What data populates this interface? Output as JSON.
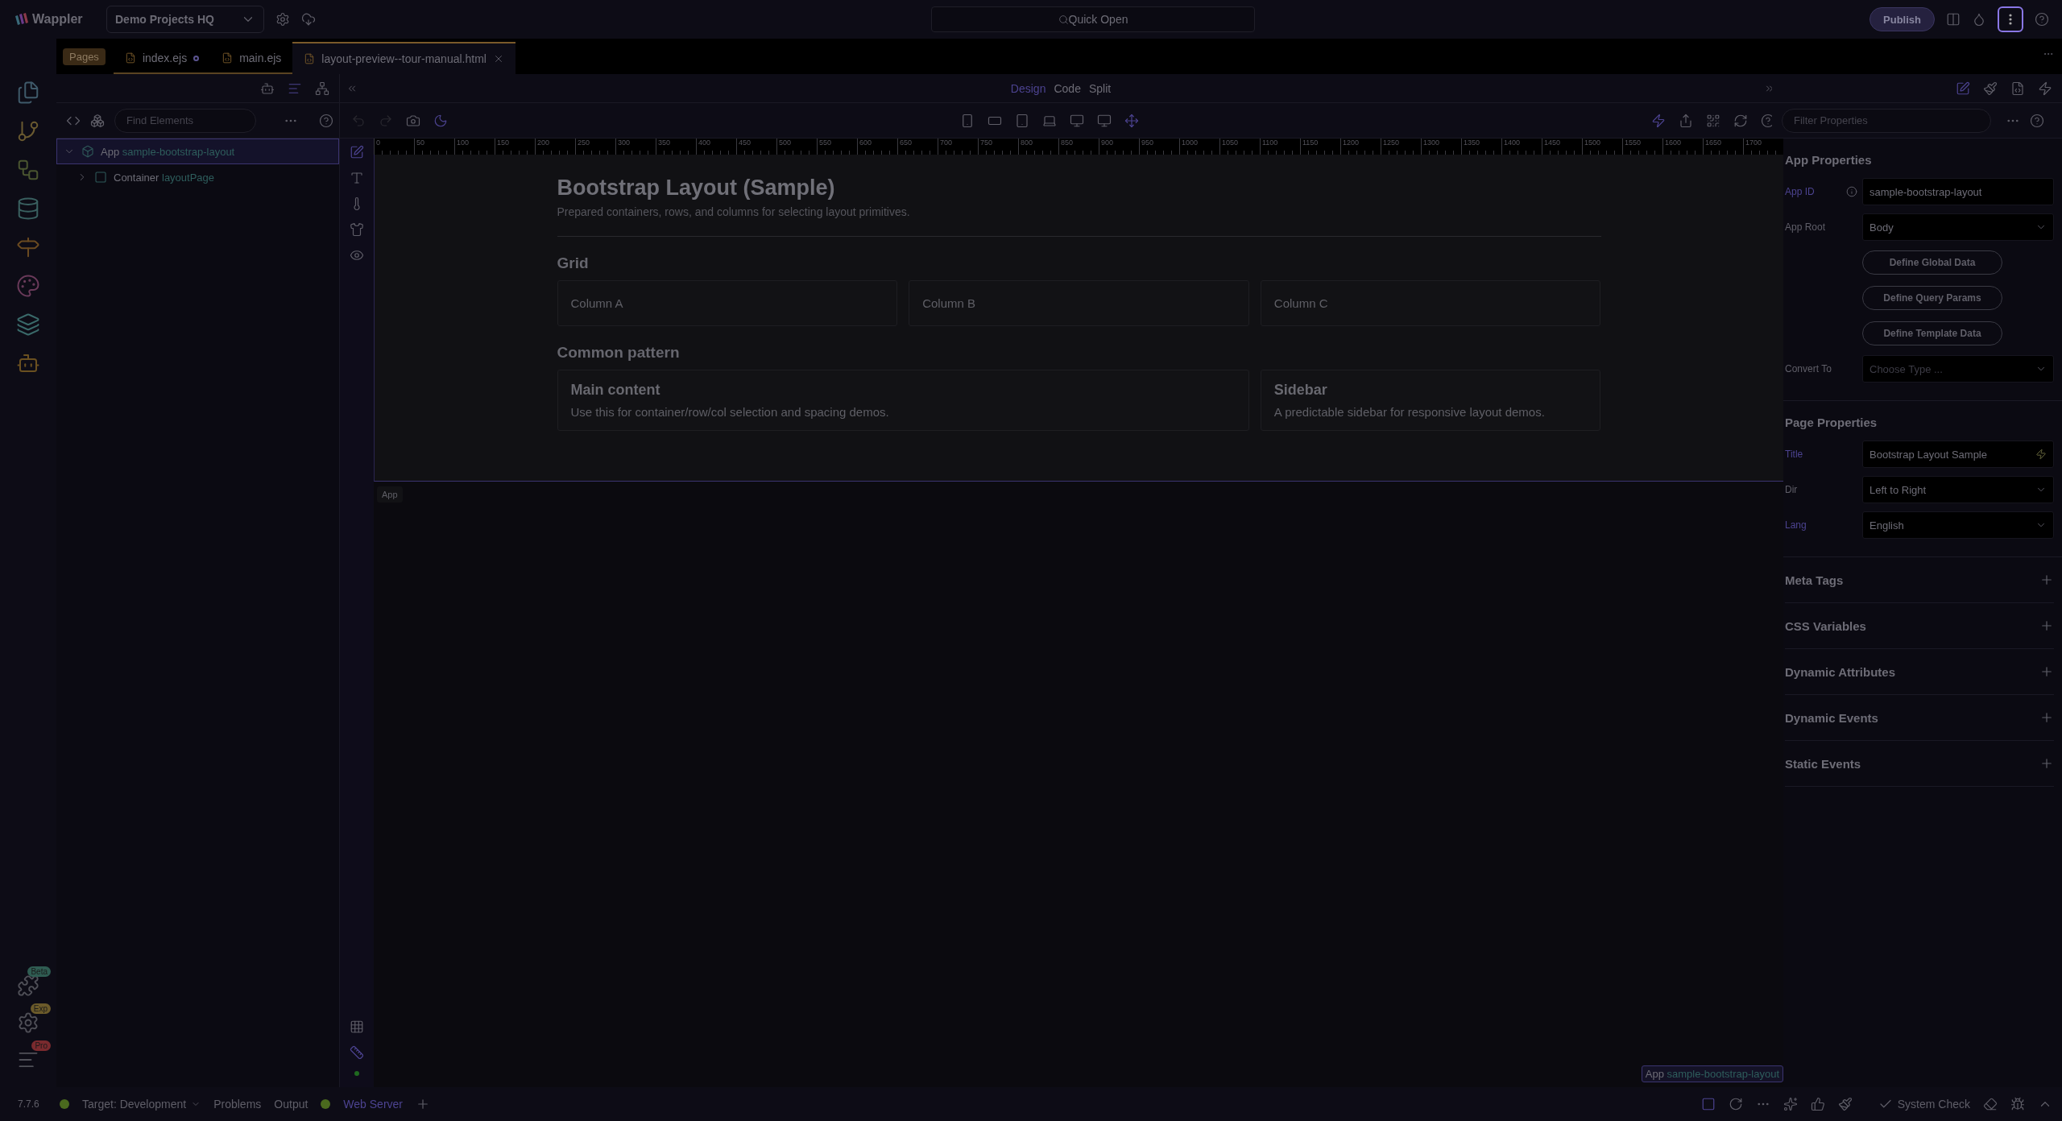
{
  "app": {
    "logo": "Wappler",
    "project": "Demo Projects HQ"
  },
  "quick_open": {
    "placeholder": "Quick Open"
  },
  "publish": "Publish",
  "tabs_label": "Pages",
  "tabs": [
    {
      "label": "index.ejs",
      "modified": true,
      "selected": false
    },
    {
      "label": "main.ejs",
      "modified": false,
      "selected": false
    },
    {
      "label": "layout-preview--tour-manual.html",
      "modified": false,
      "selected": true
    }
  ],
  "plugins": [
    {
      "badge": "Beta",
      "color": "#2f5c52"
    },
    {
      "badge": "Exp",
      "color": "#6b5a2a"
    },
    {
      "badge": "Pro",
      "color": "#7a2a2e"
    }
  ],
  "left_panel": {
    "search": {
      "placeholder": "Find Elements"
    },
    "tree": [
      {
        "type": "App",
        "name": "sample-bootstrap-layout",
        "selected": true,
        "expanded": true,
        "children": [
          {
            "type": "Container",
            "name": "layoutPage",
            "selected": false,
            "expanded": false
          }
        ]
      }
    ]
  },
  "view_modes": [
    {
      "label": "Design",
      "selected": true
    },
    {
      "label": "Code",
      "selected": false
    },
    {
      "label": "Split",
      "selected": false
    }
  ],
  "ruler": [
    "0",
    "50",
    "100",
    "150",
    "200",
    "250",
    "300",
    "350",
    "400",
    "450",
    "500",
    "550",
    "600",
    "650",
    "700",
    "750",
    "800",
    "850",
    "900",
    "950",
    "1000",
    "1050",
    "1100",
    "1150",
    "1200",
    "1250",
    "1300",
    "1350",
    "1400",
    "1450",
    "1500",
    "1550",
    "1600",
    "1650",
    "1700"
  ],
  "canvas": {
    "title": "Bootstrap Layout (Sample)",
    "subtitle": "Prepared containers, rows, and columns for selecting layout primitives.",
    "sections": [
      {
        "heading": "Grid",
        "cards": [
          {
            "text": "Column A"
          },
          {
            "text": "Column B"
          },
          {
            "text": "Column C"
          }
        ]
      },
      {
        "heading": "Common pattern",
        "cards": [
          {
            "title": "Main content",
            "text": "Use this for container/row/col selection and spacing demos."
          },
          {
            "title": "Sidebar",
            "text": "A predictable sidebar for responsive layout demos."
          }
        ]
      }
    ],
    "selection_tag": "App"
  },
  "breadcrumb": {
    "type": "App",
    "name": "sample-bootstrap-layout"
  },
  "properties": {
    "filter": {
      "placeholder": "Filter Properties"
    },
    "sections": [
      {
        "heading": "App Properties",
        "rows": [
          {
            "label": "App ID",
            "highlighted": true,
            "kind": "text",
            "info": true,
            "value": "sample-bootstrap-layout"
          },
          {
            "label": "App Root",
            "highlighted": false,
            "kind": "select",
            "value": "Body"
          },
          {
            "kind": "button",
            "text": "Define Global Data"
          },
          {
            "kind": "button",
            "text": "Define Query Params"
          },
          {
            "kind": "button",
            "text": "Define Template Data"
          },
          {
            "label": "Convert To",
            "highlighted": false,
            "kind": "select",
            "placeholder": "Choose Type ..."
          }
        ]
      },
      {
        "heading": "Page Properties",
        "rows": [
          {
            "label": "Title",
            "highlighted": true,
            "kind": "text",
            "dynamic": true,
            "value": "Bootstrap Layout Sample"
          },
          {
            "label": "Dir",
            "highlighted": false,
            "kind": "select",
            "value": "Left to Right"
          },
          {
            "label": "Lang",
            "highlighted": true,
            "kind": "select",
            "value": "English"
          }
        ]
      }
    ],
    "groups": [
      {
        "label": "Meta Tags",
        "expanded": false
      },
      {
        "label": "CSS Variables",
        "expanded": false
      },
      {
        "label": "Dynamic Attributes",
        "expanded": false
      },
      {
        "label": "Dynamic Events",
        "expanded": false
      },
      {
        "label": "Static Events",
        "expanded": false
      }
    ]
  },
  "status_bar": {
    "version": "7.7.6",
    "target": "Target:  Development",
    "items": [
      "Problems",
      "Output"
    ],
    "server": "Web Server",
    "system_check": "System Check"
  }
}
